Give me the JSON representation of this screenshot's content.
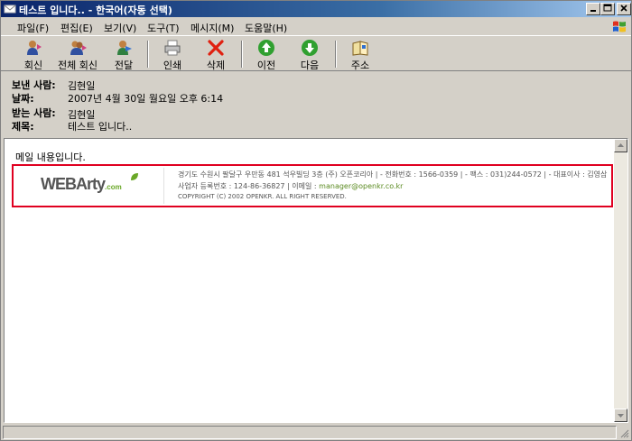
{
  "window": {
    "title": "테스트 입니다.. - 한국어(자동 선택)"
  },
  "menu": {
    "items": [
      {
        "label": "파일(F)"
      },
      {
        "label": "편집(E)"
      },
      {
        "label": "보기(V)"
      },
      {
        "label": "도구(T)"
      },
      {
        "label": "메시지(M)"
      },
      {
        "label": "도움말(H)"
      }
    ]
  },
  "toolbar": {
    "reply": "회신",
    "reply_all": "전체 회신",
    "forward": "전달",
    "print": "인쇄",
    "delete": "삭제",
    "previous": "이전",
    "next": "다음",
    "addresses": "주소"
  },
  "header": {
    "from_label": "보낸 사람:",
    "from_value": "김현일",
    "date_label": "날짜:",
    "date_value": "2007년 4월 30일 월요일 오후 6:14",
    "to_label": "받는 사람:",
    "to_value": "김현일",
    "subject_label": "제목:",
    "subject_value": "테스트 입니다.."
  },
  "message": {
    "body": "메일 내용입니다.",
    "footer": {
      "logo_main": "WEBArty",
      "logo_suffix": ".com",
      "line1": "경기도 수원시 팔달구 우만동 481 석우빌딩 3층 (주) 오픈코리아   | - 전화번호 : 1566-0359   | - 팩스 : 031)244-0572   | - 대표이사 : 김영삼",
      "line2_prefix": "사업자 등록번호 : 124-86-36827  |  이메일 : ",
      "email": "manager@openkr.co.kr",
      "line3": "COPYRIGHT (C) 2002 OPENKR. ALL RIGHT RESERVED."
    }
  },
  "colors": {
    "titlebar_start": "#0a246a",
    "footer_border": "#e00020",
    "logo_accent": "#6aa828"
  }
}
